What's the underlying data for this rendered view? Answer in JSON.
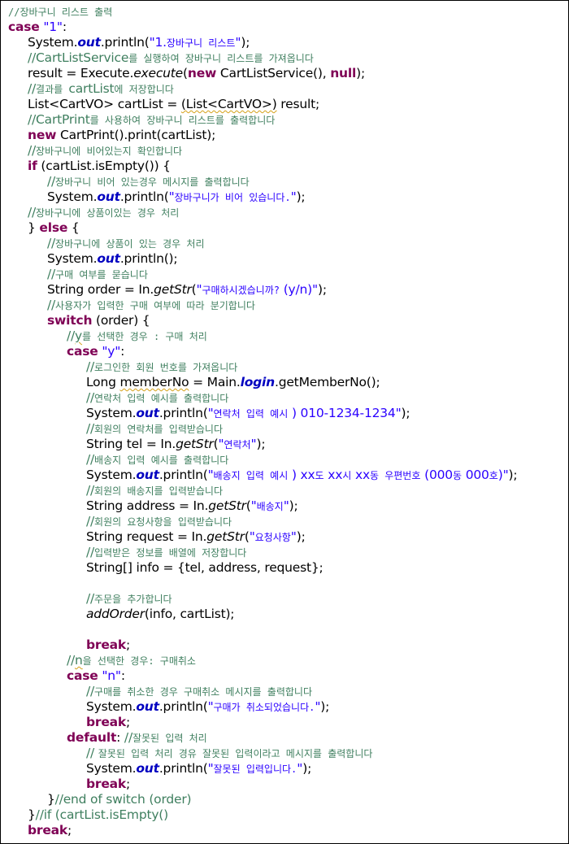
{
  "lines": [
    {
      "indent": 0,
      "tokens": [
        {
          "t": "//장바구니 리스트 출력",
          "c": "com cs"
        }
      ]
    },
    {
      "indent": 0,
      "tokens": [
        {
          "t": "case",
          "c": "kw"
        },
        {
          "t": " "
        },
        {
          "t": "\"1\"",
          "c": "str"
        },
        {
          "t": ":"
        }
      ]
    },
    {
      "indent": 1,
      "tokens": [
        {
          "t": "System."
        },
        {
          "t": "out",
          "c": "fld"
        },
        {
          "t": ".println("
        },
        {
          "t": "\"1.",
          "c": "str"
        },
        {
          "t": "장바구니 리스트",
          "c": "str cs"
        },
        {
          "t": "\"",
          "c": "str"
        },
        {
          "t": ");"
        }
      ]
    },
    {
      "indent": 1,
      "tokens": [
        {
          "t": "//CartListService",
          "c": "com"
        },
        {
          "t": "를 실행하여 장바구니 리스트를 가져옵니다",
          "c": "com cs"
        }
      ]
    },
    {
      "indent": 1,
      "tokens": [
        {
          "t": "result = Execute."
        },
        {
          "t": "execute",
          "c": "it"
        },
        {
          "t": "("
        },
        {
          "t": "new",
          "c": "kw"
        },
        {
          "t": " CartListService(), "
        },
        {
          "t": "null",
          "c": "kw"
        },
        {
          "t": ");"
        }
      ]
    },
    {
      "indent": 1,
      "tokens": [
        {
          "t": "//",
          "c": "com"
        },
        {
          "t": "결과를 ",
          "c": "com cs"
        },
        {
          "t": "cartList",
          "c": "com"
        },
        {
          "t": "에 저장합니다",
          "c": "com cs"
        }
      ]
    },
    {
      "indent": 1,
      "tokens": [
        {
          "t": "List<CartVO> cartList = "
        },
        {
          "t": "(List<CartVO>)",
          "c": "squig"
        },
        {
          "t": " result;"
        }
      ]
    },
    {
      "indent": 1,
      "tokens": [
        {
          "t": "//CartPrint",
          "c": "com"
        },
        {
          "t": "를 사용하여 장바구니 리스트를 출력합니다",
          "c": "com cs"
        }
      ]
    },
    {
      "indent": 1,
      "tokens": [
        {
          "t": "new",
          "c": "kw"
        },
        {
          "t": " CartPrint().print(cartList);"
        }
      ]
    },
    {
      "indent": 1,
      "tokens": [
        {
          "t": "//",
          "c": "com"
        },
        {
          "t": "장바구니에 비어있는지 확인합니다",
          "c": "com cs"
        }
      ]
    },
    {
      "indent": 1,
      "tokens": [
        {
          "t": "if",
          "c": "kw"
        },
        {
          "t": " (cartList.isEmpty()) {"
        }
      ]
    },
    {
      "indent": 2,
      "tokens": [
        {
          "t": "//",
          "c": "com"
        },
        {
          "t": "장바구니 비어 있는경우 메시지를 출력합니다",
          "c": "com cs"
        }
      ]
    },
    {
      "indent": 2,
      "tokens": [
        {
          "t": "System."
        },
        {
          "t": "out",
          "c": "fld"
        },
        {
          "t": ".println("
        },
        {
          "t": "\"",
          "c": "str"
        },
        {
          "t": "장바구니가 비어 있습니다.",
          "c": "str cs"
        },
        {
          "t": "\"",
          "c": "str"
        },
        {
          "t": ");"
        }
      ]
    },
    {
      "indent": 1,
      "tokens": [
        {
          "t": "//",
          "c": "com"
        },
        {
          "t": "장바구니에 상품이있는 경우 처리",
          "c": "com cs"
        }
      ]
    },
    {
      "indent": 1,
      "tokens": [
        {
          "t": "} "
        },
        {
          "t": "else",
          "c": "kw"
        },
        {
          "t": " {"
        }
      ]
    },
    {
      "indent": 2,
      "tokens": [
        {
          "t": "//",
          "c": "com"
        },
        {
          "t": "장바구니에 상품이 있는 경우 처리",
          "c": "com cs"
        }
      ]
    },
    {
      "indent": 2,
      "tokens": [
        {
          "t": "System."
        },
        {
          "t": "out",
          "c": "fld"
        },
        {
          "t": ".println();"
        }
      ]
    },
    {
      "indent": 2,
      "tokens": [
        {
          "t": "//",
          "c": "com"
        },
        {
          "t": "구매 여부를 묻습니다",
          "c": "com cs"
        }
      ]
    },
    {
      "indent": 2,
      "tokens": [
        {
          "t": "String order = In."
        },
        {
          "t": "getStr",
          "c": "it"
        },
        {
          "t": "("
        },
        {
          "t": "\"",
          "c": "str"
        },
        {
          "t": "구매하시겠습니까?",
          "c": "str cs"
        },
        {
          "t": " (y/n)\"",
          "c": "str"
        },
        {
          "t": ");"
        }
      ]
    },
    {
      "indent": 2,
      "tokens": [
        {
          "t": "//",
          "c": "com"
        },
        {
          "t": "사용자가 입력한 구매 여부에 따라 분기합니다",
          "c": "com cs"
        }
      ]
    },
    {
      "indent": 2,
      "tokens": [
        {
          "t": "switch",
          "c": "kw"
        },
        {
          "t": " (order) {"
        }
      ]
    },
    {
      "indent": 3,
      "tokens": [
        {
          "t": "//",
          "c": "com"
        },
        {
          "t": "y",
          "c": "com squig"
        },
        {
          "t": "를 선택한 경우 : 구매 처리",
          "c": "com cs"
        }
      ]
    },
    {
      "indent": 3,
      "tokens": [
        {
          "t": "case",
          "c": "kw"
        },
        {
          "t": " "
        },
        {
          "t": "\"y\"",
          "c": "str"
        },
        {
          "t": ":"
        }
      ]
    },
    {
      "indent": 4,
      "tokens": [
        {
          "t": "//",
          "c": "com"
        },
        {
          "t": "로그인한 회원 번호를 가져옵니다",
          "c": "com cs"
        }
      ]
    },
    {
      "indent": 4,
      "tokens": [
        {
          "t": "Long "
        },
        {
          "t": "memberNo",
          "c": "squig"
        },
        {
          "t": " = Main."
        },
        {
          "t": "login",
          "c": "fld"
        },
        {
          "t": ".getMemberNo();"
        }
      ]
    },
    {
      "indent": 4,
      "tokens": [
        {
          "t": "//",
          "c": "com"
        },
        {
          "t": "연락처 입력 예시를 출력합니다",
          "c": "com cs"
        }
      ]
    },
    {
      "indent": 4,
      "tokens": [
        {
          "t": "System."
        },
        {
          "t": "out",
          "c": "fld"
        },
        {
          "t": ".println("
        },
        {
          "t": "\"",
          "c": "str"
        },
        {
          "t": "연락처 입력 예시",
          "c": "str cs"
        },
        {
          "t": " ) 010-1234-1234\"",
          "c": "str"
        },
        {
          "t": ");"
        }
      ]
    },
    {
      "indent": 4,
      "tokens": [
        {
          "t": "//",
          "c": "com"
        },
        {
          "t": "회원의 연락처를 입력받습니다",
          "c": "com cs"
        }
      ]
    },
    {
      "indent": 4,
      "tokens": [
        {
          "t": "String tel = In."
        },
        {
          "t": "getStr",
          "c": "it"
        },
        {
          "t": "("
        },
        {
          "t": "\"",
          "c": "str"
        },
        {
          "t": "연락처",
          "c": "str cs"
        },
        {
          "t": "\"",
          "c": "str"
        },
        {
          "t": ");"
        }
      ]
    },
    {
      "indent": 4,
      "tokens": [
        {
          "t": "//",
          "c": "com"
        },
        {
          "t": "배송지 입력 예시를 출력합니다",
          "c": "com cs"
        }
      ]
    },
    {
      "indent": 4,
      "tokens": [
        {
          "t": "System."
        },
        {
          "t": "out",
          "c": "fld"
        },
        {
          "t": ".println("
        },
        {
          "t": "\"",
          "c": "str"
        },
        {
          "t": "배송지 입력 예시",
          "c": "str cs"
        },
        {
          "t": " ) xx",
          "c": "str"
        },
        {
          "t": "도",
          "c": "str cs"
        },
        {
          "t": " xx",
          "c": "str"
        },
        {
          "t": "시",
          "c": "str cs"
        },
        {
          "t": " xx",
          "c": "str"
        },
        {
          "t": "동 우편번호",
          "c": "str cs"
        },
        {
          "t": " (000",
          "c": "str"
        },
        {
          "t": "동",
          "c": "str cs"
        },
        {
          "t": " 000",
          "c": "str"
        },
        {
          "t": "호",
          "c": "str cs"
        },
        {
          "t": ")\"",
          "c": "str"
        },
        {
          "t": ");"
        }
      ]
    },
    {
      "indent": 4,
      "tokens": [
        {
          "t": "//",
          "c": "com"
        },
        {
          "t": "회원의 배송지를 입력받습니다",
          "c": "com cs"
        }
      ]
    },
    {
      "indent": 4,
      "tokens": [
        {
          "t": "String address = In."
        },
        {
          "t": "getStr",
          "c": "it"
        },
        {
          "t": "("
        },
        {
          "t": "\"",
          "c": "str"
        },
        {
          "t": "배송지",
          "c": "str cs"
        },
        {
          "t": "\"",
          "c": "str"
        },
        {
          "t": ");"
        }
      ]
    },
    {
      "indent": 4,
      "tokens": [
        {
          "t": "//",
          "c": "com"
        },
        {
          "t": "회원의 요청사항을 입력받습니다",
          "c": "com cs"
        }
      ]
    },
    {
      "indent": 4,
      "tokens": [
        {
          "t": "String request = In."
        },
        {
          "t": "getStr",
          "c": "it"
        },
        {
          "t": "("
        },
        {
          "t": "\"",
          "c": "str"
        },
        {
          "t": "요청사항",
          "c": "str cs"
        },
        {
          "t": "\"",
          "c": "str"
        },
        {
          "t": ");"
        }
      ]
    },
    {
      "indent": 4,
      "tokens": [
        {
          "t": "//",
          "c": "com"
        },
        {
          "t": "입력받은 정보를 배열에 저장합니다",
          "c": "com cs"
        }
      ]
    },
    {
      "indent": 4,
      "tokens": [
        {
          "t": "String[] info = {tel, address, request};"
        }
      ]
    },
    {
      "indent": 4,
      "tokens": []
    },
    {
      "indent": 4,
      "tokens": [
        {
          "t": "//",
          "c": "com"
        },
        {
          "t": "주문을 추가합니다",
          "c": "com cs"
        }
      ]
    },
    {
      "indent": 4,
      "tokens": [
        {
          "t": "addOrder",
          "c": "it"
        },
        {
          "t": "(info, cartList);"
        }
      ]
    },
    {
      "indent": 4,
      "tokens": []
    },
    {
      "indent": 4,
      "tokens": [
        {
          "t": "break",
          "c": "kw"
        },
        {
          "t": ";"
        }
      ]
    },
    {
      "indent": 3,
      "tokens": [
        {
          "t": "//",
          "c": "com"
        },
        {
          "t": "n",
          "c": "com squig"
        },
        {
          "t": "을 선택한 경우: 구매취소",
          "c": "com cs"
        }
      ]
    },
    {
      "indent": 3,
      "tokens": [
        {
          "t": "case",
          "c": "kw"
        },
        {
          "t": " "
        },
        {
          "t": "\"n\"",
          "c": "str"
        },
        {
          "t": ":"
        }
      ]
    },
    {
      "indent": 4,
      "tokens": [
        {
          "t": "//",
          "c": "com"
        },
        {
          "t": "구매를 취소한 경우 구매취소 메시지를 출력합니다",
          "c": "com cs"
        }
      ]
    },
    {
      "indent": 4,
      "tokens": [
        {
          "t": "System."
        },
        {
          "t": "out",
          "c": "fld"
        },
        {
          "t": ".println("
        },
        {
          "t": "\"",
          "c": "str"
        },
        {
          "t": "구매가 취소되었습니다.",
          "c": "str cs"
        },
        {
          "t": "\"",
          "c": "str"
        },
        {
          "t": ");"
        }
      ]
    },
    {
      "indent": 4,
      "tokens": [
        {
          "t": "break",
          "c": "kw"
        },
        {
          "t": ";"
        }
      ]
    },
    {
      "indent": 3,
      "tokens": [
        {
          "t": "default",
          "c": "kw"
        },
        {
          "t": ": "
        },
        {
          "t": "//",
          "c": "com"
        },
        {
          "t": "잘못된 입력 처리",
          "c": "com cs"
        }
      ]
    },
    {
      "indent": 4,
      "tokens": [
        {
          "t": "// ",
          "c": "com"
        },
        {
          "t": "잘못된 입력 처리 경유 잘못된 입력이라고 메시지를 출력합니다",
          "c": "com cs"
        }
      ]
    },
    {
      "indent": 4,
      "tokens": [
        {
          "t": "System."
        },
        {
          "t": "out",
          "c": "fld"
        },
        {
          "t": ".println("
        },
        {
          "t": "\"",
          "c": "str"
        },
        {
          "t": "잘못된 입력입니다.",
          "c": "str cs"
        },
        {
          "t": "\"",
          "c": "str"
        },
        {
          "t": ");"
        }
      ]
    },
    {
      "indent": 4,
      "tokens": [
        {
          "t": "break",
          "c": "kw"
        },
        {
          "t": ";"
        }
      ]
    },
    {
      "indent": 2,
      "tokens": [
        {
          "t": "}"
        },
        {
          "t": "//end of switch (order)",
          "c": "com"
        }
      ]
    },
    {
      "indent": 1,
      "tokens": [
        {
          "t": "}"
        },
        {
          "t": "//if (cartList.isEmpty()",
          "c": "com"
        }
      ]
    },
    {
      "indent": 1,
      "tokens": [
        {
          "t": "break",
          "c": "kw"
        },
        {
          "t": ";"
        }
      ]
    }
  ]
}
